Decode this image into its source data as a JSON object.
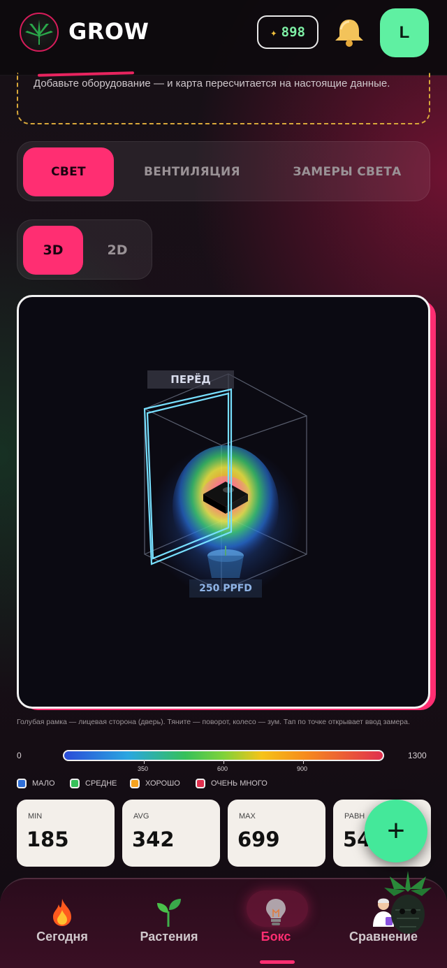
{
  "header": {
    "brand": "GROW",
    "coins": "898",
    "avatar_letter": "L"
  },
  "notice": {
    "text": "Добавьте оборудование — и карта пересчитается на настоящие данные."
  },
  "tabs": [
    {
      "label": "СВЕТ",
      "active": true
    },
    {
      "label": "ВЕНТИЛЯЦИЯ",
      "active": false
    },
    {
      "label": "ЗАМЕРЫ СВЕТА",
      "active": false
    }
  ],
  "views": [
    {
      "label": "3D",
      "active": true
    },
    {
      "label": "2D",
      "active": false
    }
  ],
  "scene": {
    "front_label": "ПЕРЁД",
    "ppfd_label": "250 PPFD"
  },
  "hint": "Голубая рамка — лицевая сторона (дверь). Тяните — поворот, колесо — зум. Тап по точке открывает ввод замера.",
  "scale": {
    "min": "0",
    "max": "1300",
    "ticks": [
      "350",
      "600",
      "900"
    ]
  },
  "legend": [
    {
      "label": "МАЛО",
      "color": "#2f6fd8"
    },
    {
      "label": "СРЕДНЕ",
      "color": "#36c05a"
    },
    {
      "label": "ХОРОШО",
      "color": "#f6a21e"
    },
    {
      "label": "ОЧЕНЬ МНОГО",
      "color": "#e0304e"
    }
  ],
  "stats": [
    {
      "label": "MIN",
      "value": "185"
    },
    {
      "label": "AVG",
      "value": "342"
    },
    {
      "label": "MAX",
      "value": "699"
    },
    {
      "label": "РАВН",
      "value": "54"
    }
  ],
  "fab": {
    "label": "+"
  },
  "nav": [
    {
      "label": "Сегодня",
      "icon": "fire-icon",
      "active": false
    },
    {
      "label": "Растения",
      "icon": "sprout-icon",
      "active": false
    },
    {
      "label": "Бокс",
      "icon": "lightbulb-icon",
      "active": true
    },
    {
      "label": "Сравнение",
      "icon": "scientist-icon",
      "active": false
    }
  ],
  "colors": {
    "accent": "#ff2e72",
    "mint": "#44e89a",
    "notice_border": "#d8a83a"
  }
}
